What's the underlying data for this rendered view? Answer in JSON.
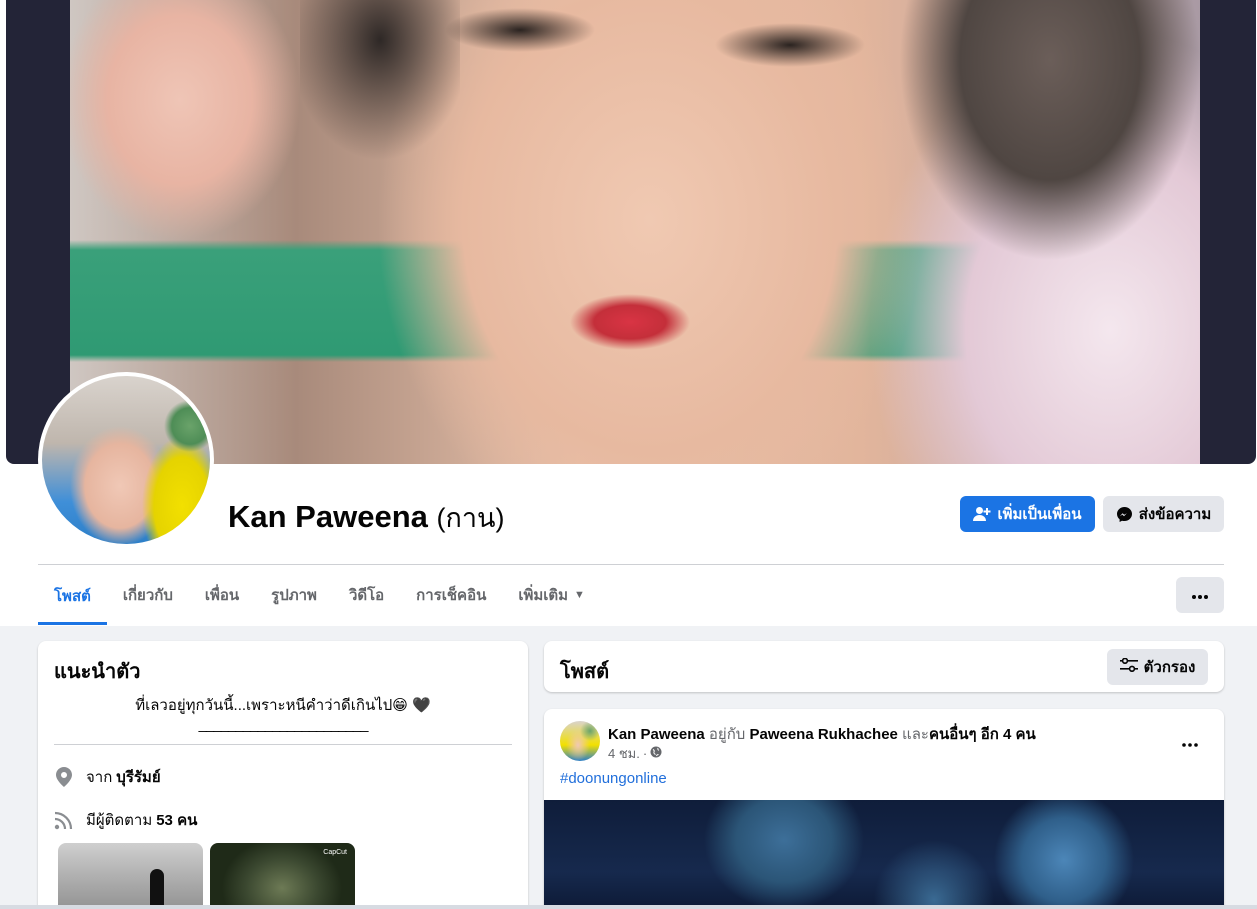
{
  "profile": {
    "name": "Kan Paweena",
    "alt_name": "(กาน)"
  },
  "actions": {
    "add_friend_label": "เพิ่มเป็นเพื่อน",
    "message_label": "ส่งข้อความ"
  },
  "tabs": [
    {
      "label": "โพสต์",
      "active": true
    },
    {
      "label": "เกี่ยวกับ",
      "active": false
    },
    {
      "label": "เพื่อน",
      "active": false
    },
    {
      "label": "รูปภาพ",
      "active": false
    },
    {
      "label": "วิดีโอ",
      "active": false
    },
    {
      "label": "การเช็คอิน",
      "active": false
    },
    {
      "label": "เพิ่มเติม",
      "active": false
    }
  ],
  "intro": {
    "title": "แนะนำตัว",
    "bio_line1": "ที่เลวอยู่ทุกวันนี้...เพราะหนีคำว่าดีเกินไป😁 🖤",
    "bio_line2": "_______________________",
    "from_prefix": "จาก",
    "from_value": "บุรีรัมย์",
    "followers_prefix": "มีผู้ติดตาม",
    "followers_value": "53 คน",
    "thumb_badge": "CapCut"
  },
  "posts": {
    "title": "โพสต์",
    "filter_label": "ตัวกรอง"
  },
  "post": {
    "author": "Kan Paweena",
    "with_text": "อยู่กับ",
    "tagged": "Paweena Rukhachee",
    "and_text": "และ",
    "others": "คนอื่นๆ อีก 4 คน",
    "time": "4 ชม.",
    "separator": "·",
    "hashtag": "#doonungonline"
  },
  "colors": {
    "accent": "#1b74e4",
    "page_bg": "#f0f2f5",
    "secondary_btn": "#e4e6eb",
    "link": "#216fdb"
  }
}
